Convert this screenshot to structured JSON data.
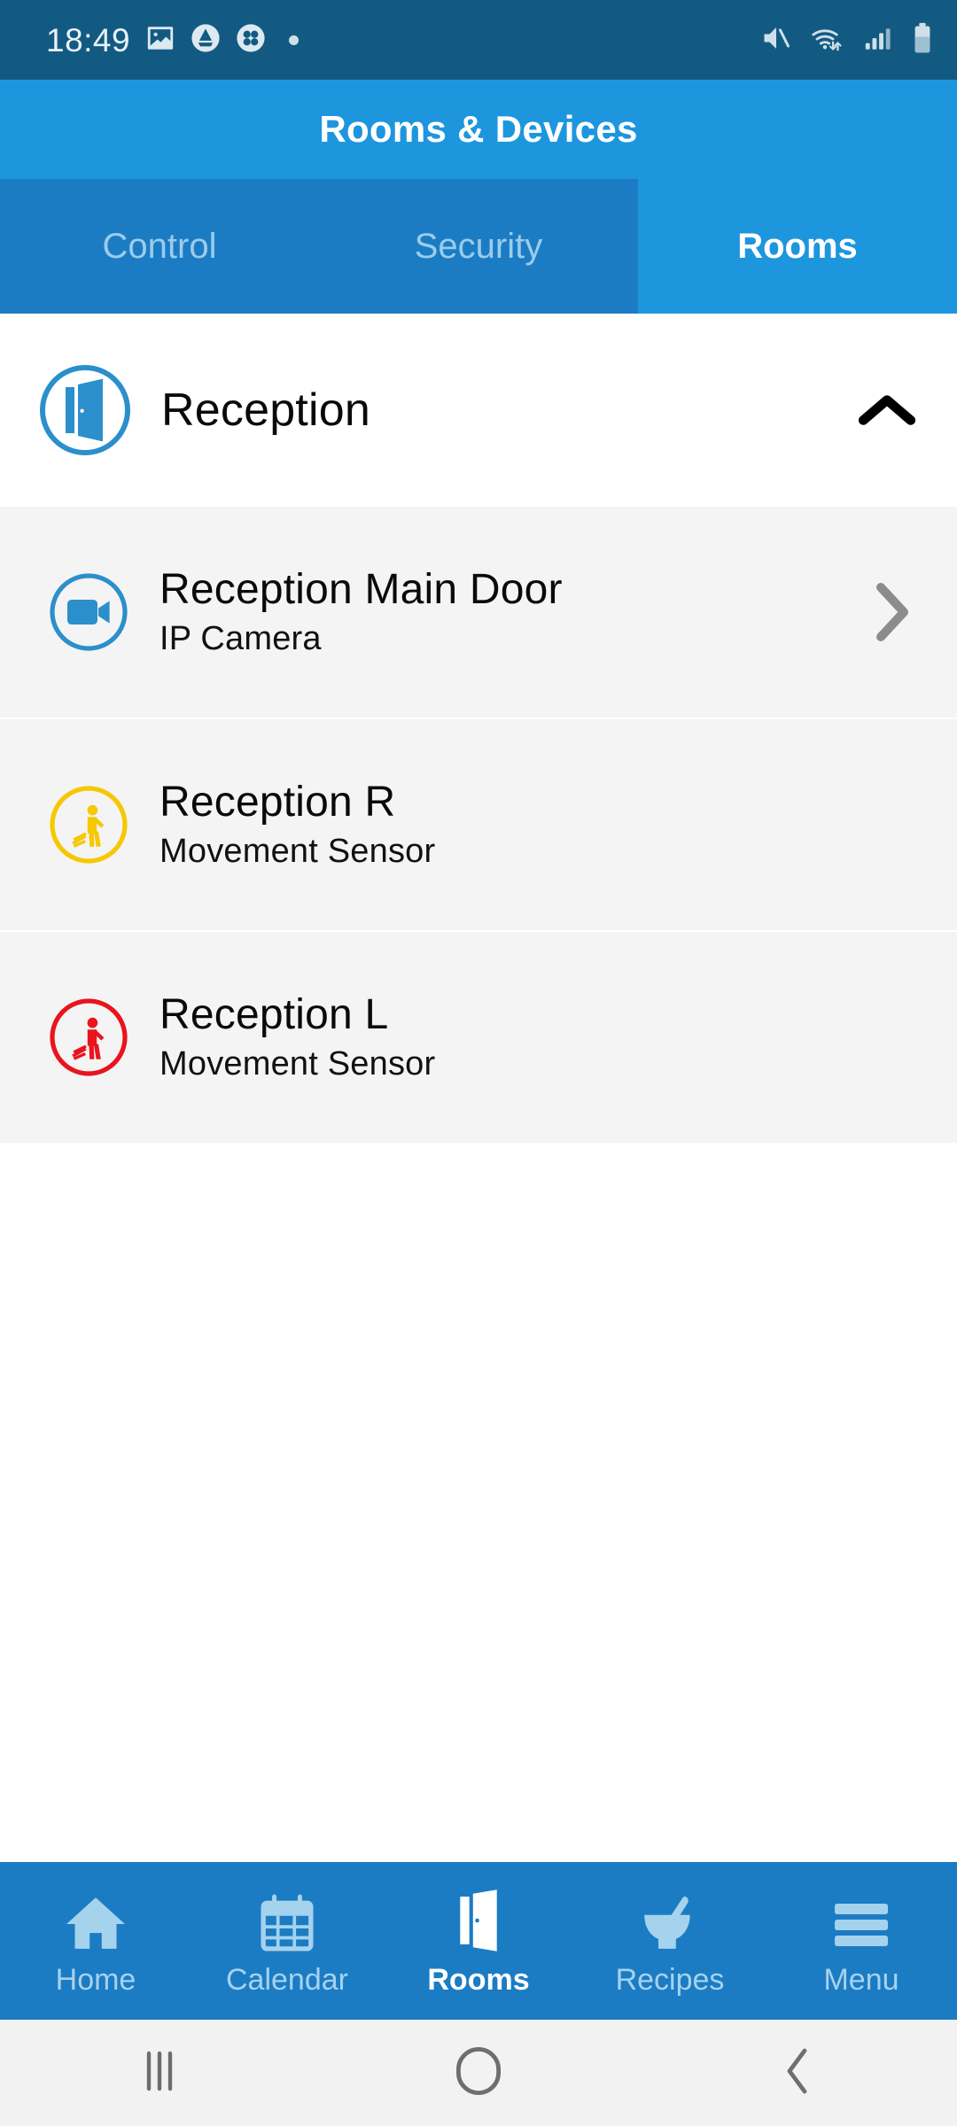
{
  "status_bar": {
    "time": "18:49",
    "left_icons": [
      "image-icon",
      "drive-triangle-icon",
      "clover-icon",
      "dot-indicator"
    ],
    "right_icons": [
      "volume-mute-icon",
      "wifi-icon",
      "cellular-signal-icon",
      "battery-icon"
    ]
  },
  "header": {
    "title": "Rooms & Devices",
    "background": "#1E96DE"
  },
  "tabs": [
    {
      "label": "Control",
      "active": false
    },
    {
      "label": "Security",
      "active": false
    },
    {
      "label": "Rooms",
      "active": true
    }
  ],
  "rooms": [
    {
      "name": "Reception",
      "icon": "open-door-icon",
      "icon_color": "#2B8FCB",
      "expanded": true,
      "chevron": "chevron-up-icon",
      "devices": [
        {
          "name": "Reception Main Door",
          "type": "IP Camera",
          "icon": "video-camera-icon",
          "icon_color": "#2B8FCB",
          "chevron": "chevron-right-icon",
          "has_chevron": true
        },
        {
          "name": "Reception R",
          "type": "Movement Sensor",
          "icon": "motion-sensor-icon",
          "icon_color": "#F5C800",
          "chevron": "",
          "has_chevron": false
        },
        {
          "name": "Reception L",
          "type": "Movement Sensor",
          "icon": "motion-sensor-icon",
          "icon_color": "#E8141E",
          "chevron": "",
          "has_chevron": false
        }
      ]
    }
  ],
  "bottom_nav": [
    {
      "label": "Home",
      "icon": "house-icon",
      "active": false
    },
    {
      "label": "Calendar",
      "icon": "calendar-icon",
      "active": false
    },
    {
      "label": "Rooms",
      "icon": "open-door-icon",
      "active": true
    },
    {
      "label": "Recipes",
      "icon": "mortar-pestle-icon",
      "active": false
    },
    {
      "label": "Menu",
      "icon": "hamburger-menu-icon",
      "active": false
    }
  ],
  "android_nav": [
    {
      "name": "recents-button",
      "icon": "recents-icon"
    },
    {
      "name": "home-button",
      "icon": "home-circle-icon"
    },
    {
      "name": "back-button",
      "icon": "back-chevron-icon"
    }
  ],
  "colors": {
    "status_bar_bg": "#135A82",
    "header_bg": "#1E96DE",
    "tab_inactive_bg": "#1B7CC4",
    "tab_active_bg": "#1E96DE",
    "room_row_bg": "#FFFFFF",
    "device_row_bg": "#F4F4F4",
    "bottom_nav_bg": "#1B7CC4",
    "android_nav_bg": "#F2F2F2"
  }
}
